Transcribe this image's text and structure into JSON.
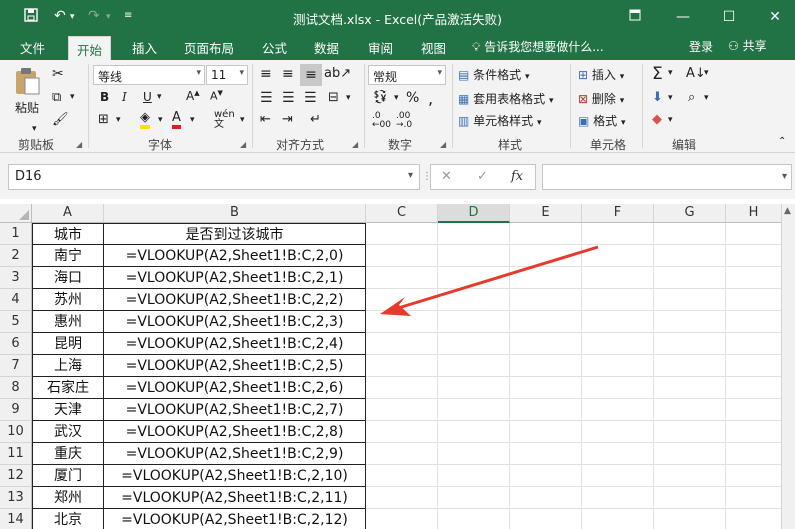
{
  "window": {
    "title": "测试文档.xlsx - Excel(产品激活失败)"
  },
  "menu": {
    "tabs": [
      "文件",
      "开始",
      "插入",
      "页面布局",
      "公式",
      "数据",
      "审阅",
      "视图"
    ],
    "active_tab": "开始",
    "tell_me": "告诉我您想要做什么...",
    "login": "登录",
    "share": "共享"
  },
  "ribbon": {
    "clipboard": {
      "paste": "粘贴",
      "label": "剪贴板"
    },
    "font": {
      "name": "等线",
      "size": "11",
      "bold": "B",
      "italic": "I",
      "underline": "U",
      "label": "字体"
    },
    "alignment": {
      "label": "对齐方式"
    },
    "number": {
      "format": "常规",
      "label": "数字"
    },
    "styles": {
      "conditional": "条件格式",
      "table": "套用表格格式",
      "cell": "单元格样式",
      "label": "样式"
    },
    "cells": {
      "insert": "插入",
      "delete": "删除",
      "format": "格式",
      "label": "单元格"
    },
    "editing": {
      "label": "编辑"
    }
  },
  "formula_bar": {
    "name_box": "D16",
    "fx": "fx",
    "content": ""
  },
  "sheet": {
    "columns": [
      "A",
      "B",
      "C",
      "D",
      "E",
      "F",
      "G",
      "H"
    ],
    "selected_column": "D",
    "rows": [
      {
        "n": "1",
        "a": "城市",
        "b": "是否到过该城市"
      },
      {
        "n": "2",
        "a": "南宁",
        "b": "=VLOOKUP(A2,Sheet1!B:C,2,0)"
      },
      {
        "n": "3",
        "a": "海口",
        "b": "=VLOOKUP(A2,Sheet1!B:C,2,1)"
      },
      {
        "n": "4",
        "a": "苏州",
        "b": "=VLOOKUP(A2,Sheet1!B:C,2,2)"
      },
      {
        "n": "5",
        "a": "惠州",
        "b": "=VLOOKUP(A2,Sheet1!B:C,2,3)"
      },
      {
        "n": "6",
        "a": "昆明",
        "b": "=VLOOKUP(A2,Sheet1!B:C,2,4)"
      },
      {
        "n": "7",
        "a": "上海",
        "b": "=VLOOKUP(A2,Sheet1!B:C,2,5)"
      },
      {
        "n": "8",
        "a": "石家庄",
        "b": "=VLOOKUP(A2,Sheet1!B:C,2,6)"
      },
      {
        "n": "9",
        "a": "天津",
        "b": "=VLOOKUP(A2,Sheet1!B:C,2,7)"
      },
      {
        "n": "10",
        "a": "武汉",
        "b": "=VLOOKUP(A2,Sheet1!B:C,2,8)"
      },
      {
        "n": "11",
        "a": "重庆",
        "b": "=VLOOKUP(A2,Sheet1!B:C,2,9)"
      },
      {
        "n": "12",
        "a": "厦门",
        "b": "=VLOOKUP(A2,Sheet1!B:C,2,10)"
      },
      {
        "n": "13",
        "a": "郑州",
        "b": "=VLOOKUP(A2,Sheet1!B:C,2,11)"
      },
      {
        "n": "14",
        "a": "北京",
        "b": "=VLOOKUP(A2,Sheet1!B:C,2,12)"
      }
    ]
  },
  "colors": {
    "excel_green": "#217346",
    "annotation_arrow": "#e53a2c"
  }
}
